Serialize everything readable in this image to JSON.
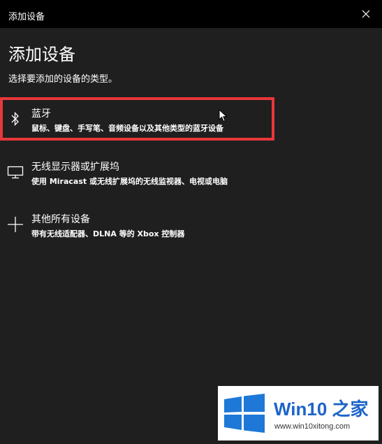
{
  "window": {
    "title": "添加设备",
    "close_symbol": "✕"
  },
  "page": {
    "heading": "添加设备",
    "subheading": "选择要添加的设备的类型。"
  },
  "options": [
    {
      "icon": "bluetooth-icon",
      "label": "蓝牙",
      "description": "鼠标、键盘、手写笔、音频设备以及其他类型的蓝牙设备"
    },
    {
      "icon": "monitor-icon",
      "label": "无线显示器或扩展坞",
      "description": "使用 Miracast 或无线扩展坞的无线监视器、电视或电脑"
    },
    {
      "icon": "plus-icon",
      "label": "其他所有设备",
      "description": "带有无线适配器、DLNA 等的 Xbox 控制器"
    }
  ],
  "annotation": {
    "highlight_color": "#e8373a"
  },
  "watermark": {
    "title": "Win10 之家",
    "url": "www.win10xitong.com",
    "logo_color": "#1e78d7"
  }
}
